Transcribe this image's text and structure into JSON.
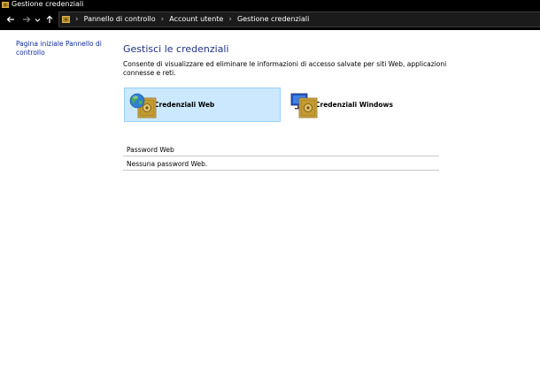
{
  "window": {
    "title": "Gestione credenziali"
  },
  "nav": {
    "breadcrumbs": [
      "Pannello di controllo",
      "Account utente",
      "Gestione credenziali"
    ]
  },
  "sidebar": {
    "link_label": "Pagina iniziale Pannello di controllo"
  },
  "main": {
    "title": "Gestisci le credenziali",
    "description": "Consente di visualizzare ed eliminare le informazioni di accesso salvate per siti Web, applicazioni connesse e reti.",
    "tiles": [
      {
        "label": "Credenziali Web",
        "selected": true
      },
      {
        "label": "Credenziali Windows",
        "selected": false
      }
    ],
    "section": {
      "header": "Password Web",
      "empty_text": "Nessuna password Web."
    }
  },
  "colors": {
    "accent_title": "#1e3287",
    "link": "#0b2a9a",
    "selected_tile_bg": "#cce8ff",
    "selected_tile_border": "#99d1ff"
  },
  "icons": {
    "app": "vault-icon",
    "back": "arrow-left-icon",
    "forward": "arrow-right-icon",
    "recent": "chevron-down-icon",
    "up": "arrow-up-icon",
    "web_tile": "globe-vault-icon",
    "windows_tile": "monitor-vault-icon"
  }
}
